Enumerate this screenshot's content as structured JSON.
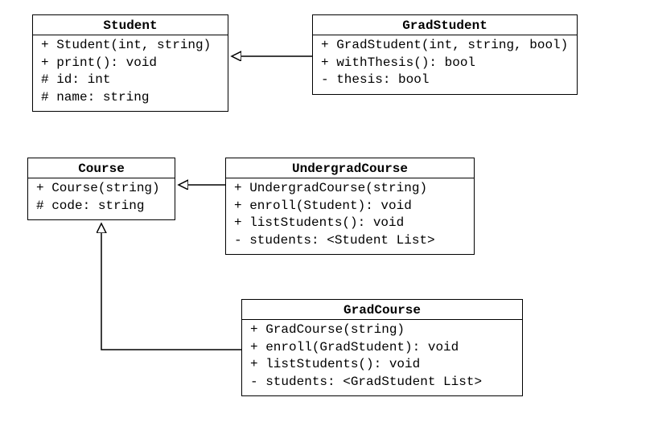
{
  "classes": {
    "student": {
      "name": "Student",
      "members": [
        "+ Student(int, string)",
        "+ print(): void",
        "# id: int",
        "# name: string"
      ]
    },
    "gradStudent": {
      "name": "GradStudent",
      "members": [
        "+ GradStudent(int, string, bool)",
        "+ withThesis(): bool",
        "- thesis: bool"
      ]
    },
    "course": {
      "name": "Course",
      "members": [
        "+ Course(string)",
        "# code: string"
      ]
    },
    "undergradCourse": {
      "name": "UndergradCourse",
      "members": [
        "+ UndergradCourse(string)",
        "+ enroll(Student): void",
        "+ listStudents(): void",
        "- students: <Student List>"
      ]
    },
    "gradCourse": {
      "name": "GradCourse",
      "members": [
        "+ GradCourse(string)",
        "+ enroll(GradStudent): void",
        "+ listStudents(): void",
        "- students: <GradStudent List>"
      ]
    }
  },
  "relationships": [
    {
      "child": "GradStudent",
      "parent": "Student",
      "type": "inheritance"
    },
    {
      "child": "UndergradCourse",
      "parent": "Course",
      "type": "inheritance"
    },
    {
      "child": "GradCourse",
      "parent": "Course",
      "type": "inheritance"
    }
  ]
}
